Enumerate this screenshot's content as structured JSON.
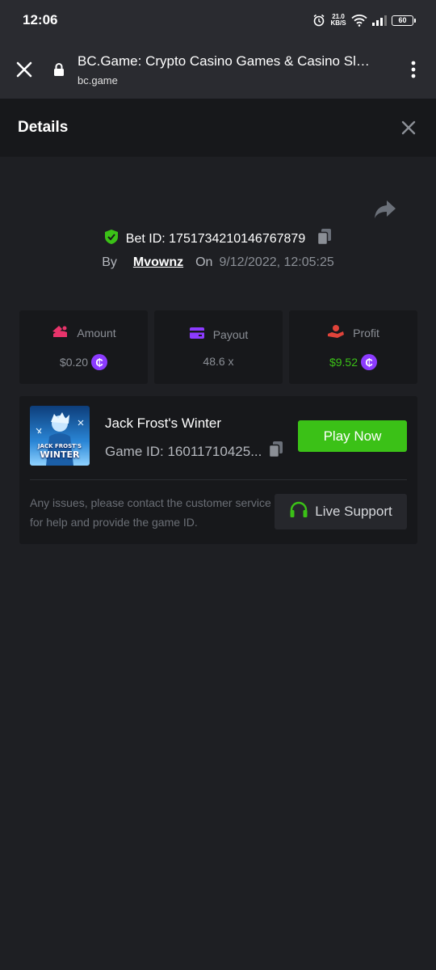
{
  "status_bar": {
    "time": "12:06",
    "net_speed_value": "21.0",
    "net_speed_unit": "KB/S",
    "battery": "60"
  },
  "browser": {
    "title": "BC.Game: Crypto Casino Games & Casino Sl…",
    "url": "bc.game"
  },
  "details": {
    "title": "Details"
  },
  "bet": {
    "label": "Bet ID:",
    "id": "1751734210146767879",
    "by_label": "By",
    "user": "Mvownz",
    "on_label": "On",
    "date": "9/12/2022, 12:05:25"
  },
  "stats": {
    "amount_label": "Amount",
    "amount_value": "$0.20",
    "payout_label": "Payout",
    "payout_value": "48.6 x",
    "profit_label": "Profit",
    "profit_value": "$9.52",
    "coin_symbol": "₵"
  },
  "game": {
    "name": "Jack Frost's Winter",
    "id_text": "Game ID: 16011710425...",
    "thumb_line1": "JACK FROST'S",
    "thumb_line2": "WINTER",
    "play_label": "Play Now"
  },
  "support": {
    "text": "Any issues, please contact the customer service for help and provide the game ID.",
    "button_label": "Live Support"
  },
  "colors": {
    "accent_green": "#3bc117",
    "coin_purple": "#8c3bff",
    "amount_pink": "#e8346b",
    "payout_purple": "#8c3bff",
    "profit_red": "#e0433a"
  }
}
